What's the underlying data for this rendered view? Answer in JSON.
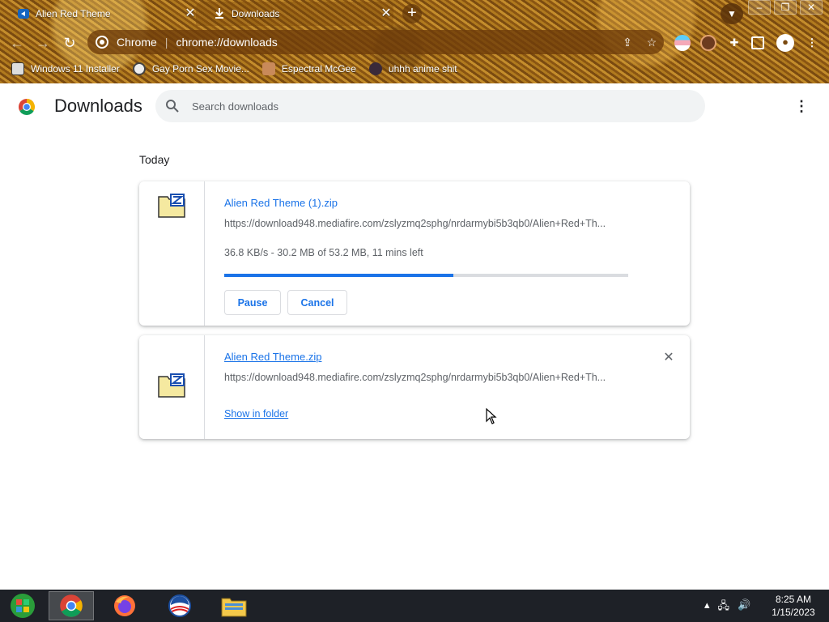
{
  "browser": {
    "tabs": [
      {
        "title": "Alien Red Theme",
        "active": false
      },
      {
        "title": "Downloads",
        "active": true
      }
    ],
    "omnibox": {
      "site_name": "Chrome",
      "separator": "|",
      "url": "chrome://downloads"
    },
    "bookmarks": [
      {
        "label": "Windows 11 Installer"
      },
      {
        "label": "Gay Porn Sex Movie..."
      },
      {
        "label": "Espectral McGee"
      },
      {
        "label": "uhhh anime shit"
      }
    ]
  },
  "page": {
    "title": "Downloads",
    "search_placeholder": "Search downloads",
    "section_label": "Today",
    "downloads": [
      {
        "file_name": "Alien Red Theme (1).zip",
        "url": "https://download948.mediafire.com/zslyzmq2sphg/nrdarmybi5b3qb0/Alien+Red+Th...",
        "status": "36.8 KB/s - 30.2 MB of 53.2 MB, 11 mins left",
        "progress_fraction": 0.5677,
        "pause_label": "Pause",
        "cancel_label": "Cancel"
      },
      {
        "file_name": "Alien Red Theme.zip",
        "url": "https://download948.mediafire.com/zslyzmq2sphg/nrdarmybi5b3qb0/Alien+Red+Th...",
        "show_in_folder_label": "Show in folder",
        "remove_label": "✕"
      }
    ]
  },
  "taskbar": {
    "apps": [
      "start",
      "chrome",
      "firefox",
      "obama-app",
      "file-explorer"
    ],
    "clock_time": "8:25 AM",
    "clock_date": "1/15/2023"
  },
  "colors": {
    "accent": "#1a73e8",
    "taskbar": "#1e2127",
    "text_secondary": "#5f6368"
  }
}
